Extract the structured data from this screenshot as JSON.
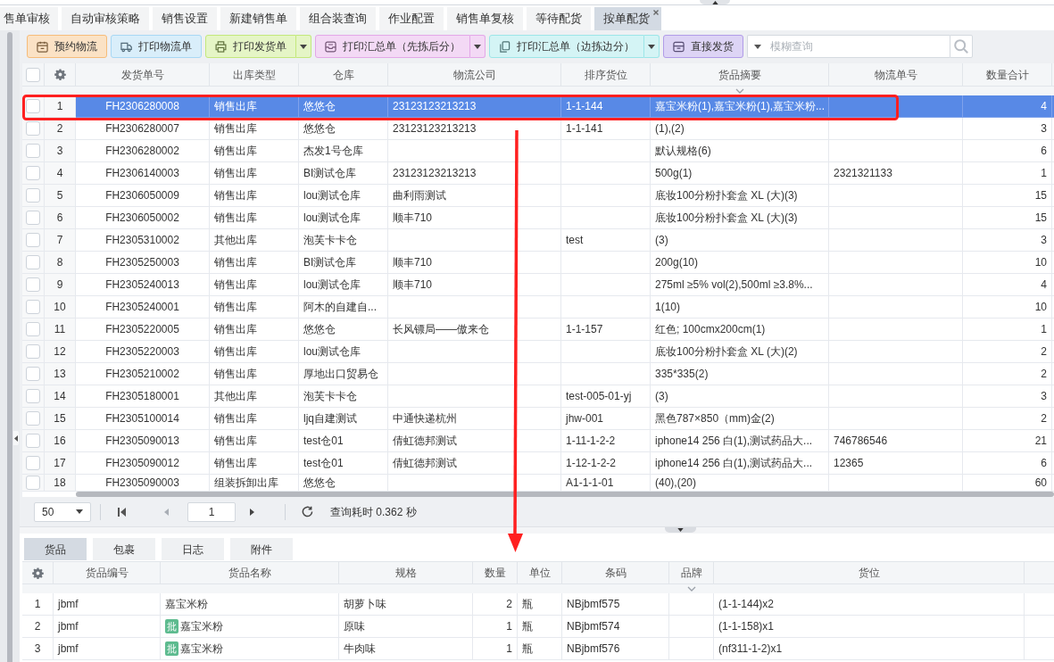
{
  "top_tabs": [
    {
      "label": "售单审核",
      "selected": false,
      "closable": false
    },
    {
      "label": "自动审核策略",
      "selected": false,
      "closable": false
    },
    {
      "label": "销售设置",
      "selected": false,
      "closable": false
    },
    {
      "label": "新建销售单",
      "selected": false,
      "closable": false
    },
    {
      "label": "组合装查询",
      "selected": false,
      "closable": false
    },
    {
      "label": "作业配置",
      "selected": false,
      "closable": false
    },
    {
      "label": "销售单复核",
      "selected": false,
      "closable": false
    },
    {
      "label": "等待配货",
      "selected": false,
      "closable": false
    },
    {
      "label": "按单配货",
      "selected": true,
      "closable": true
    }
  ],
  "toolbar": {
    "buttons": [
      {
        "label": "预约物流",
        "color": "#fbe2c5",
        "dropdown": false
      },
      {
        "label": "打印物流单",
        "color": "#d9eefa",
        "dropdown": false
      },
      {
        "label": "打印发货单",
        "color": "#e5f5c6",
        "dropdown": true
      },
      {
        "label": "打印汇总单（先拣后分）",
        "color": "#f3d9f5",
        "dropdown": true
      },
      {
        "label": "打印汇总单（边拣边分）",
        "color": "#d4f4f5",
        "dropdown": true
      },
      {
        "label": "直接发货",
        "color": "#ddd4f5",
        "dropdown": false
      }
    ],
    "search": {
      "placeholder": "模糊查询"
    }
  },
  "main_table": {
    "all_checked": false,
    "columns": [
      {
        "label": "发货单号",
        "caret": false
      },
      {
        "label": "出库类型",
        "caret": false
      },
      {
        "label": "仓库",
        "caret": false
      },
      {
        "label": "物流公司",
        "caret": false
      },
      {
        "label": "排序货位",
        "caret": false
      },
      {
        "label": "货品摘要",
        "caret": true
      },
      {
        "label": "物流单号",
        "caret": false
      },
      {
        "label": "数量合计",
        "caret": false
      }
    ],
    "rows": [
      {
        "no": "1",
        "checked": false,
        "selected": true,
        "order_no": "FH2306280008",
        "outbound_type": "销售出库",
        "warehouse": "悠悠仓",
        "carrier": "23123123213213",
        "sort_location": "1-1-144",
        "goods_summary": "嘉宝米粉(1),嘉宝米粉(1),嘉宝米粉...",
        "total_qty": "4"
      },
      {
        "no": "2",
        "checked": false,
        "selected": false,
        "order_no": "FH2306280007",
        "outbound_type": "销售出库",
        "warehouse": "悠悠仓",
        "carrier": "23123123213213",
        "sort_location": "1-1-141",
        "goods_summary": "(1),(2)",
        "total_qty": "3"
      },
      {
        "no": "3",
        "checked": false,
        "selected": false,
        "order_no": "FH2306280002",
        "outbound_type": "销售出库",
        "warehouse": "杰发1号仓库",
        "goods_summary": "默认规格(6)",
        "total_qty": "6"
      },
      {
        "no": "4",
        "checked": false,
        "selected": false,
        "order_no": "FH2306140003",
        "outbound_type": "销售出库",
        "warehouse": "BI测试仓库",
        "carrier": "23123123213213",
        "goods_summary": "500g(1)",
        "tracking_no": "2321321133",
        "total_qty": "1"
      },
      {
        "no": "5",
        "checked": false,
        "selected": false,
        "order_no": "FH2306050009",
        "outbound_type": "销售出库",
        "warehouse": "lou测试仓库",
        "carrier": "曲利雨测试",
        "goods_summary": "底妆100分粉扑套盒 XL (大)(3)",
        "total_qty": "15"
      },
      {
        "no": "6",
        "checked": false,
        "selected": false,
        "order_no": "FH2306050002",
        "outbound_type": "销售出库",
        "warehouse": "lou测试仓库",
        "carrier": "顺丰710",
        "goods_summary": "底妆100分粉扑套盒 XL (大)(3)",
        "total_qty": "15"
      },
      {
        "no": "7",
        "checked": false,
        "selected": false,
        "order_no": "FH2305310002",
        "outbound_type": "其他出库",
        "warehouse": "泡芙卡卡仓",
        "sort_location": "test",
        "goods_summary": "(3)",
        "total_qty": "3"
      },
      {
        "no": "8",
        "checked": false,
        "selected": false,
        "order_no": "FH2305250003",
        "outbound_type": "销售出库",
        "warehouse": "BI测试仓库",
        "carrier": "顺丰710",
        "goods_summary": "200g(10)",
        "total_qty": "10"
      },
      {
        "no": "9",
        "checked": false,
        "selected": false,
        "order_no": "FH2305240013",
        "outbound_type": "销售出库",
        "warehouse": "lou测试仓库",
        "carrier": "顺丰710",
        "goods_summary": "275ml ≥5% vol(2),500ml ≥3.8%...",
        "total_qty": "4"
      },
      {
        "no": "10",
        "checked": false,
        "selected": false,
        "order_no": "FH2305240001",
        "outbound_type": "销售出库",
        "warehouse": "阿木的自建自...",
        "goods_summary": "1(10)",
        "total_qty": "10"
      },
      {
        "no": "11",
        "checked": false,
        "selected": false,
        "order_no": "FH2305220005",
        "outbound_type": "销售出库",
        "warehouse": "悠悠仓",
        "carrier": "长风镖局——傲来仓",
        "sort_location": "1-1-157",
        "goods_summary": "红色; 100cmx200cm(1)",
        "total_qty": "1"
      },
      {
        "no": "12",
        "checked": false,
        "selected": false,
        "order_no": "FH2305220003",
        "outbound_type": "销售出库",
        "warehouse": "lou测试仓库",
        "goods_summary": "底妆100分粉扑套盒 XL (大)(2)",
        "total_qty": "2"
      },
      {
        "no": "13",
        "checked": false,
        "selected": false,
        "order_no": "FH2305210002",
        "outbound_type": "销售出库",
        "warehouse": "厚地出口贸易仓",
        "goods_summary": "335*335(2)",
        "total_qty": "2"
      },
      {
        "no": "14",
        "checked": false,
        "selected": false,
        "order_no": "FH2305180001",
        "outbound_type": "其他出库",
        "warehouse": "泡芙卡卡仓",
        "sort_location": "test-005-01-yj",
        "goods_summary": "(3)",
        "total_qty": "3"
      },
      {
        "no": "15",
        "checked": false,
        "selected": false,
        "order_no": "FH2305100014",
        "outbound_type": "销售出库",
        "warehouse": "ljq自建测试",
        "carrier": "中通快递杭州",
        "sort_location": "jhw-001",
        "goods_summary": "黑色787×850（mm)金(2)",
        "total_qty": "2"
      },
      {
        "no": "16",
        "checked": false,
        "selected": false,
        "order_no": "FH2305090013",
        "outbound_type": "销售出库",
        "warehouse": "test仓01",
        "carrier": "倩虹德邦测试",
        "sort_location": "1-11-1-2-2",
        "goods_summary": "iphone14 256 白(1),测试药品大...",
        "tracking_no": "746786546",
        "total_qty": "21"
      },
      {
        "no": "17",
        "checked": false,
        "selected": false,
        "order_no": "FH2305090012",
        "outbound_type": "销售出库",
        "warehouse": "test仓01",
        "carrier": "倩虹德邦测试",
        "sort_location": "1-12-1-2-2",
        "goods_summary": "iphone14 256 白(1),测试药品大...",
        "tracking_no": "12365",
        "total_qty": "6"
      },
      {
        "no": "18",
        "checked": false,
        "selected": false,
        "order_no": "FH2305090003",
        "outbound_type": "组装拆卸出库",
        "warehouse": "悠悠仓",
        "sort_location": "A1-1-1-01",
        "goods_summary": "(40),(20)",
        "total_qty": "60"
      }
    ]
  },
  "pagination": {
    "page_size": "50",
    "page": "1",
    "query_time": "查询耗时 0.362 秒"
  },
  "detail": {
    "tabs": [
      {
        "label": "货品",
        "selected": true
      },
      {
        "label": "包裹",
        "selected": false
      },
      {
        "label": "日志",
        "selected": false
      },
      {
        "label": "附件",
        "selected": false
      }
    ],
    "columns": [
      {
        "label": "货品编号",
        "caret": false
      },
      {
        "label": "货品名称",
        "caret": false
      },
      {
        "label": "规格",
        "caret": false
      },
      {
        "label": "数量",
        "caret": false
      },
      {
        "label": "单位",
        "caret": false
      },
      {
        "label": "条码",
        "caret": false
      },
      {
        "label": "品牌",
        "caret": true
      },
      {
        "label": "货位",
        "caret": false
      }
    ],
    "rows": [
      {
        "no": "1",
        "goods_code": "jbmf",
        "goods_name": "嘉宝米粉",
        "spec": "胡萝卜味",
        "qty": "2",
        "unit": "瓶",
        "barcode": "NBjbmf575",
        "location": "(1-1-144)x2"
      },
      {
        "no": "2",
        "goods_code": "jbmf",
        "badge": "批",
        "goods_name": "嘉宝米粉",
        "spec": "原味",
        "qty": "1",
        "unit": "瓶",
        "barcode": "NBjbmf574",
        "location": "(1-1-158)x1"
      },
      {
        "no": "3",
        "goods_code": "jbmf",
        "badge": "批",
        "goods_name": "嘉宝米粉",
        "spec": "牛肉味",
        "qty": "1",
        "unit": "瓶",
        "barcode": "NBjbmf576",
        "location": "(nf311-1-2)x1"
      }
    ]
  }
}
